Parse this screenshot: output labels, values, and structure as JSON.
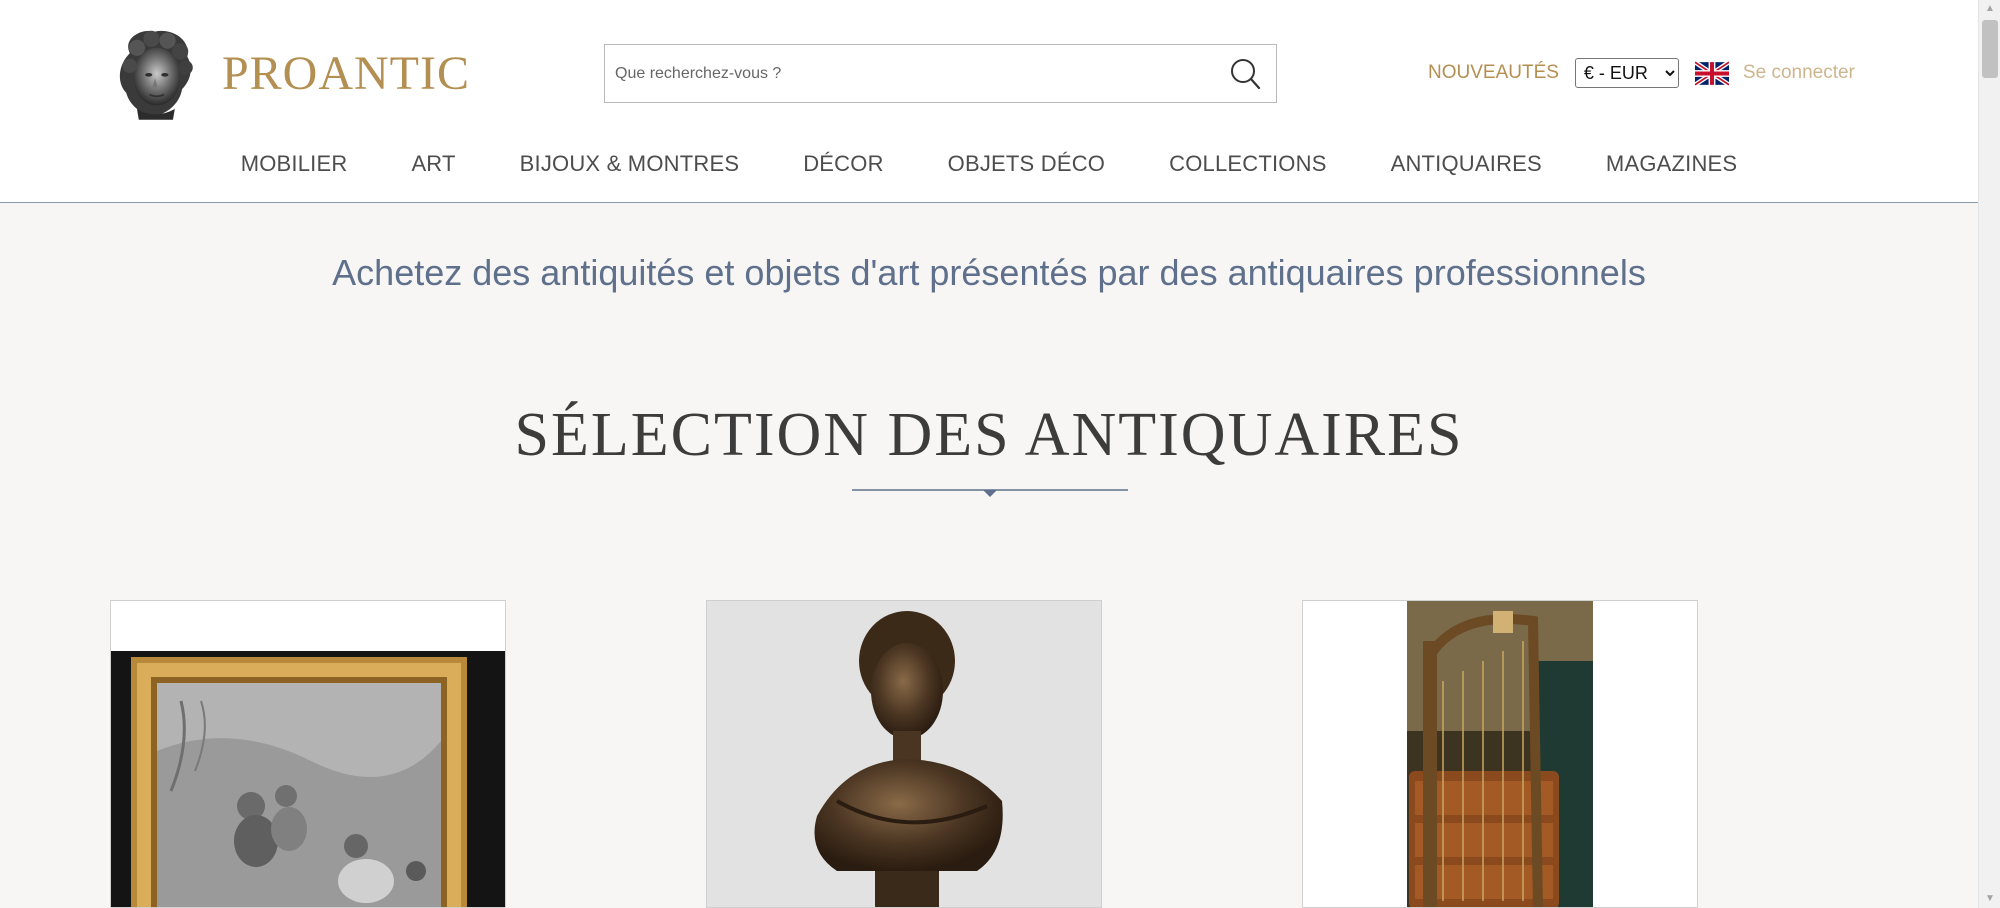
{
  "brand": {
    "name": "PROANTIC"
  },
  "search": {
    "placeholder": "Que recherchez-vous ?"
  },
  "top_links": {
    "nouveautes": "NOUVEAUTÉS",
    "currency": {
      "selected": "€ - EUR"
    },
    "login": "Se connecter"
  },
  "nav": {
    "items": [
      {
        "label": "MOBILIER"
      },
      {
        "label": "ART"
      },
      {
        "label": "BIJOUX & MONTRES"
      },
      {
        "label": "DÉCOR"
      },
      {
        "label": "OBJETS DÉCO"
      },
      {
        "label": "COLLECTIONS"
      },
      {
        "label": "ANTIQUAIRES"
      },
      {
        "label": "MAGAZINES"
      }
    ]
  },
  "main": {
    "tagline": "Achetez des antiquités et objets d'art présentés par des antiquaires professionnels",
    "section_title": "SÉLECTION DES ANTIQUAIRES"
  },
  "products": [
    {
      "image": "framed-engraving"
    },
    {
      "image": "bronze-bust"
    },
    {
      "image": "harp-and-commode"
    }
  ],
  "colors": {
    "gold": "#b48f52",
    "slate": "#5e708b",
    "background": "#f7f6f4"
  }
}
